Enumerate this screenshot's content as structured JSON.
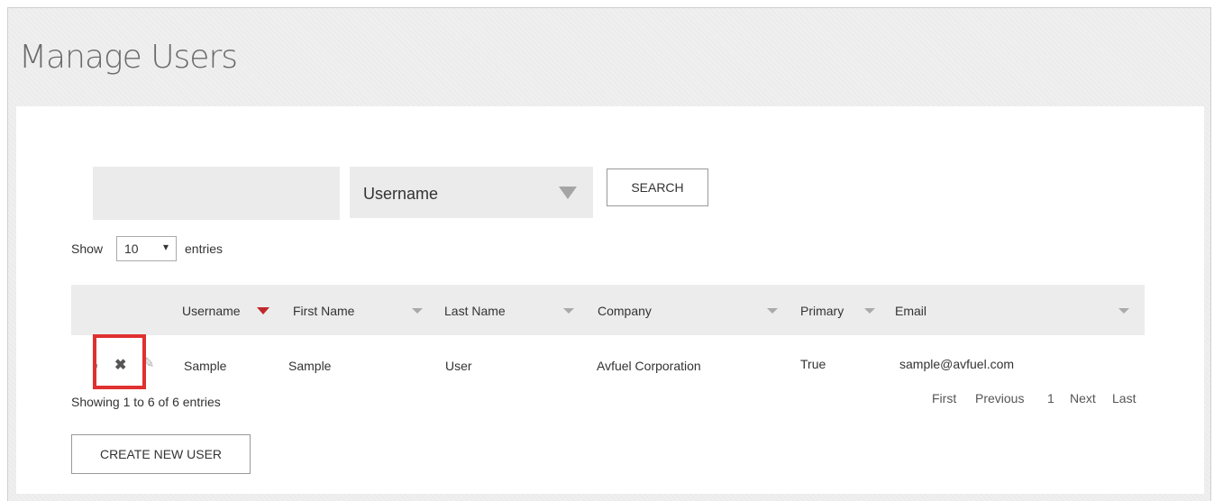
{
  "page": {
    "title": "Manage Users"
  },
  "search": {
    "input_value": "",
    "field_select": "Username",
    "search_button": "SEARCH"
  },
  "length": {
    "show": "Show",
    "value": "10",
    "entries": "entries"
  },
  "table": {
    "columns": [
      "Username",
      "First Name",
      "Last Name",
      "Company",
      "Primary",
      "Email"
    ],
    "rows": [
      {
        "username": "Sample",
        "first_name": "Sample",
        "last_name": "User",
        "company": "Avfuel Corporation",
        "primary": "True",
        "email": "sample@avfuel.com"
      }
    ]
  },
  "info": "Showing 1 to 6 of 6 entries",
  "pagination": {
    "first": "First",
    "previous": "Previous",
    "page": "1",
    "next": "Next",
    "last": "Last"
  },
  "actions": {
    "create_user": "CREATE NEW USER"
  },
  "icons": {
    "delete": "close-icon",
    "edit": "pencil-icon",
    "view": "user-icon"
  },
  "colors": {
    "sort_active": "#c0272d",
    "highlight": "#e03030"
  }
}
